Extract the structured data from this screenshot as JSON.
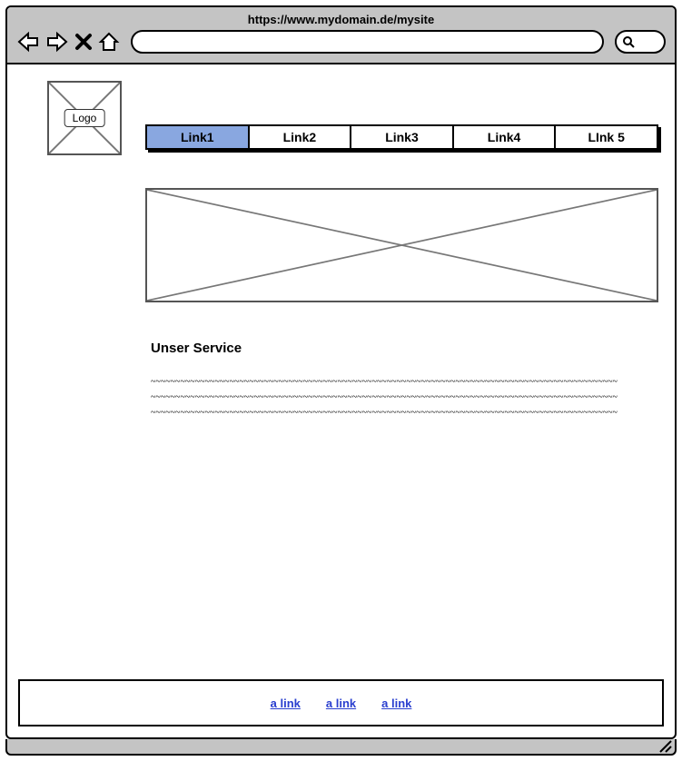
{
  "browser": {
    "url": "https://www.mydomain.de/mysite"
  },
  "logo": {
    "label": "Logo"
  },
  "nav": {
    "items": [
      {
        "label": "Link1",
        "active": true
      },
      {
        "label": "Link2",
        "active": false
      },
      {
        "label": "Link3",
        "active": false
      },
      {
        "label": "Link4",
        "active": false
      },
      {
        "label": "LInk 5",
        "active": false
      }
    ]
  },
  "section": {
    "title": "Unser Service",
    "lorem": "~~~~~~~~~~~~~~~~~~~~~~~~~~~~~~~~~~~~~~~~~~~~~~~~~~~~~~~~~~~~~~~~~~~~~~~~~~~~~~~~~~~~~~~~~~~~~~~~~~~~~~~~~~~~~~~~~~~~~~~~~~~~~~~~~~~~~~~~~~~~~~~~~~~~~~~~~~~~~~~~~~~~~~~~~~~~~~~~~~~~~~~~~~~~~~~~~~~~~~~~~~~~~~~~~~~~~~~~~~~~~~~~~~~~~~~~~~~~~~~~~~~~~~~~~~~~~~~~~~~~~~~~~~~~~~~~~~~~~~~~~~~~~~~~~~~~~~~~~~~~~~~~~~~~~~~~~~~~~~~~~~~~~~~~~~~~~~~~~~~~~~~~~~~~~~~~~~~~~~~~~~~~~~~~~~~~~~~~~~~~~~~~~~~~~~~~~~~~~~~~~~~~~~~~~~~~~~~~~~~~~~~~~~~~~~~~~~~~~~~~~~~~"
  },
  "footer": {
    "links": [
      {
        "label": "a link"
      },
      {
        "label": "a link"
      },
      {
        "label": "a link"
      }
    ]
  }
}
